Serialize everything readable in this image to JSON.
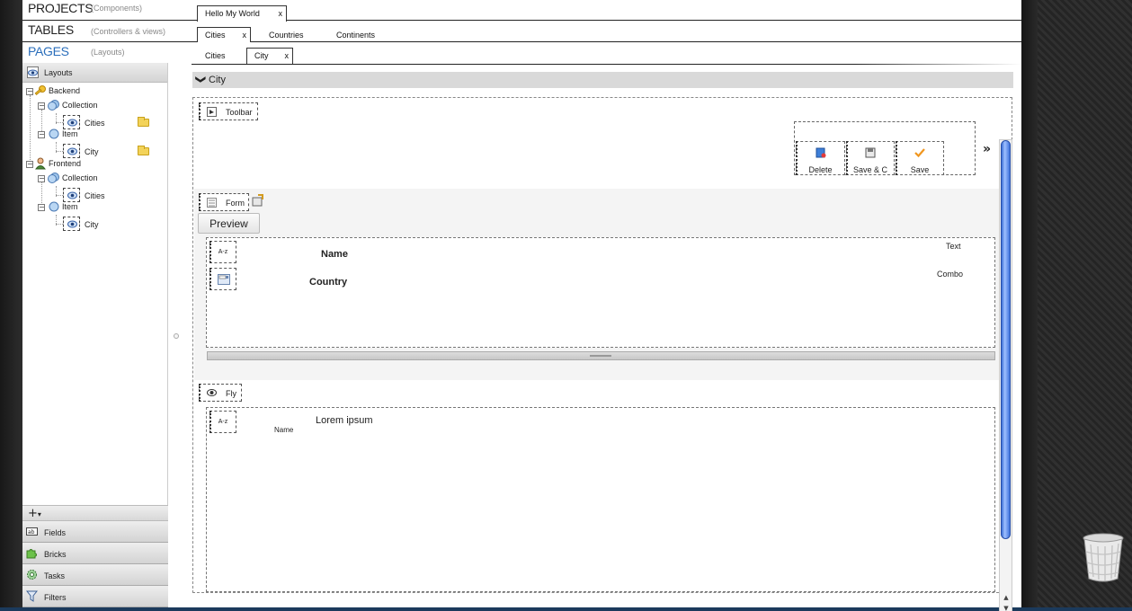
{
  "header": {
    "projects_label": "PROJECTS",
    "projects_sub": "(Components)",
    "tables_label": "TABLES",
    "tables_sub": "(Controllers & views)",
    "pages_label": "PAGES",
    "pages_sub": "(Layouts)"
  },
  "project_tabs": [
    {
      "label": "Hello My World",
      "close": "x"
    }
  ],
  "table_tabs": [
    {
      "label": "Cities",
      "close": "x"
    },
    {
      "label": "Countries"
    },
    {
      "label": "Continents"
    }
  ],
  "page_tabs": [
    {
      "label": "Cities"
    },
    {
      "label": "City",
      "close": "x"
    }
  ],
  "sidebar": {
    "title": "Layouts",
    "tree": {
      "backend": "Backend",
      "backend_collection": "Collection",
      "backend_cities": "Cities",
      "backend_item": "Item",
      "backend_city": "City",
      "frontend": "Frontend",
      "frontend_collection": "Collection",
      "frontend_cities": "Cities",
      "frontend_item": "Item",
      "frontend_city": "City"
    },
    "add_label": "+",
    "add_caret": "▾",
    "panels": [
      "Fields",
      "Bricks",
      "Tasks",
      "Filters"
    ]
  },
  "main": {
    "section_title": "City",
    "section_chevron": "❯",
    "toolbar_tag": "Toolbar",
    "toolbar_buttons": [
      "Delete",
      "Save & C",
      "Save"
    ],
    "more_icon": "»",
    "form_tag": "Form",
    "preview_label": "Preview",
    "fields": [
      {
        "type_label": "A-z",
        "label": "Name",
        "kind": "Text"
      },
      {
        "type_label": "",
        "label": "Country",
        "kind": "Combo"
      }
    ],
    "fly_tag": "Fly",
    "fly_field": {
      "type_label": "A-z",
      "title": "Lorem ipsum",
      "sub": "Name"
    }
  },
  "colors": {
    "pages_accent": "#2a6ebb",
    "scroll_thumb": "#3b6fd6",
    "section_bar": "#d9d9d9"
  }
}
